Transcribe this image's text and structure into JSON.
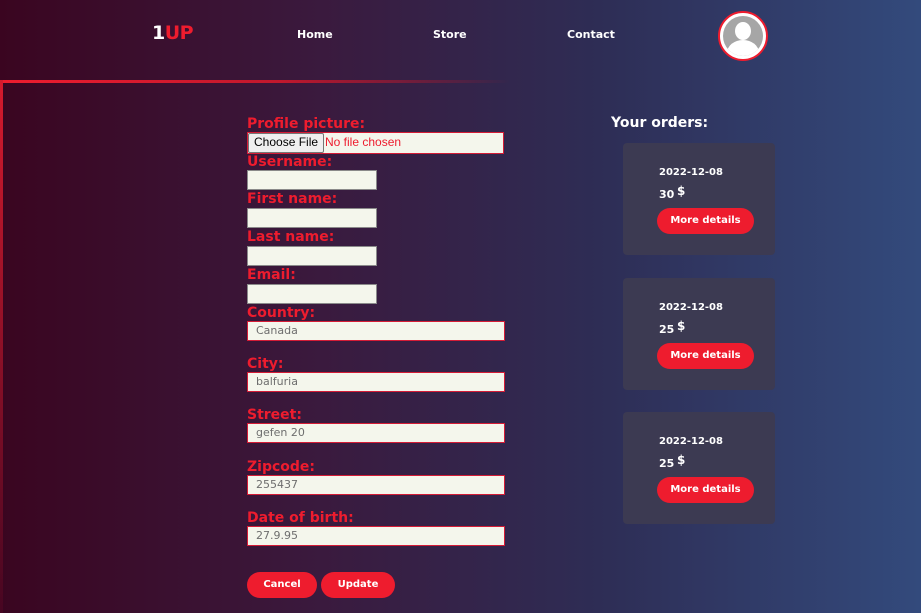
{
  "header": {
    "logo_one": "1",
    "logo_up": "UP",
    "nav": [
      "Home",
      "Store",
      "Contact"
    ],
    "avatar_icon": "user-avatar-icon"
  },
  "form": {
    "profile_picture_label": "Profile picture:",
    "choose_file_label": "Choose File",
    "no_file_text": "No file chosen",
    "username_label": "Username:",
    "username_value": "",
    "first_name_label": "First name:",
    "first_name_value": "",
    "last_name_label": "Last name:",
    "last_name_value": "",
    "email_label": "Email:",
    "email_value": "",
    "country_label": "Country:",
    "country_value": "Canada",
    "city_label": "City:",
    "city_value": "balfuria",
    "street_label": "Street:",
    "street_value": "gefen 20",
    "zipcode_label": "Zipcode:",
    "zipcode_value": "255437",
    "dob_label": "Date of birth:",
    "dob_value": "27.9.95",
    "cancel_label": "Cancel",
    "update_label": "Update"
  },
  "orders": {
    "title": "Your orders:",
    "items": [
      {
        "date": "2022-12-08",
        "amount": "30",
        "currency": "$",
        "button": "More details"
      },
      {
        "date": "2022-12-08",
        "amount": "25",
        "currency": "$",
        "button": "More details"
      },
      {
        "date": "2022-12-08",
        "amount": "25",
        "currency": "$",
        "button": "More details"
      }
    ]
  },
  "colors": {
    "accent": "#ee1c2e",
    "card": "#3c3a52",
    "input_bg": "#f4f6ec"
  }
}
